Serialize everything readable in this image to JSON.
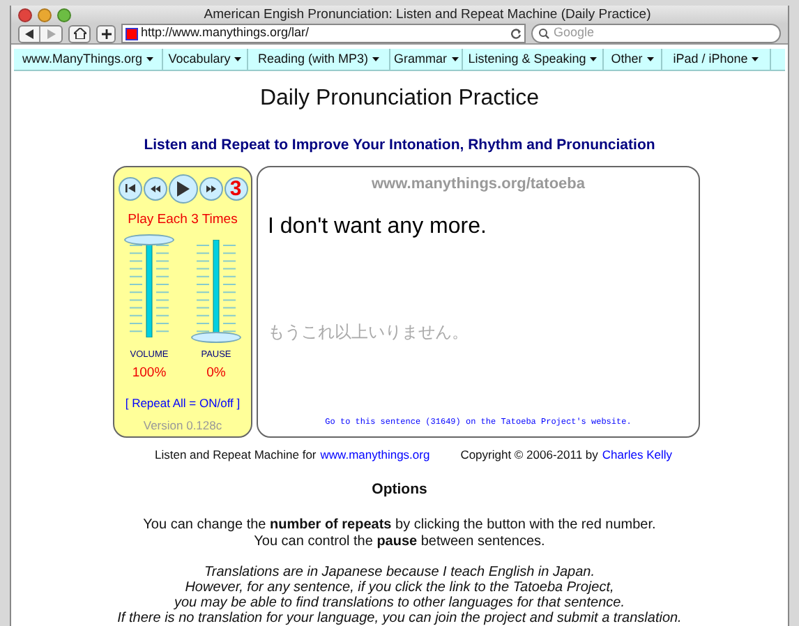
{
  "window": {
    "title": "American Engish Pronunciation: Listen and Repeat Machine (Daily Practice)"
  },
  "toolbar": {
    "url": "http://www.manythings.org/lar/",
    "search_placeholder": "Google"
  },
  "menu": [
    {
      "label": "www.ManyThings.org"
    },
    {
      "label": "Vocabulary"
    },
    {
      "label": "Reading (with MP3)"
    },
    {
      "label": "Grammar"
    },
    {
      "label": "Listening & Speaking"
    },
    {
      "label": "Other"
    },
    {
      "label": "iPad / iPhone"
    }
  ],
  "heading": "Daily Pronunciation Practice",
  "subheading": "Listen and Repeat to Improve Your Intonation, Rhythm and Pronunciation",
  "player": {
    "repeat_count": "3",
    "play_label": "Play Each 3 Times",
    "sliders": [
      {
        "label": "VOLUME",
        "level": 1,
        "reading": "100%"
      },
      {
        "label": "PAUSE",
        "level": 0,
        "reading": "0%"
      }
    ],
    "repeat_all": "[ Repeat All = ON/off ]",
    "version": "Version 0.128c"
  },
  "card": {
    "site": "www.manythings.org/tatoeba",
    "sentence": "I don't want any more.",
    "translation": "もうこれ以上いりません。",
    "tatoeba_link": "Go to this sentence (31649) on the Tatoeba Project's website."
  },
  "footer": {
    "text": "Listen and Repeat Machine for",
    "link": "www.manythings.org",
    "copyright": "Copyright © 2006-2011 by",
    "author_link": "Charles Kelly"
  },
  "options": {
    "title": "Options",
    "lines": [
      "You can change the **number of repeats** by clicking the button with the red number.",
      "You can control the **pause** between sentences."
    ],
    "italic_lines": [
      "Translations are in Japanese because I teach English in Japan.",
      "However, for any sentence, if you click the link to the Tatoeba Project,",
      "you may be able to find translations to other languages for that sentence.",
      "If there is no translation for your language, you can join the project and submit a translation."
    ]
  }
}
